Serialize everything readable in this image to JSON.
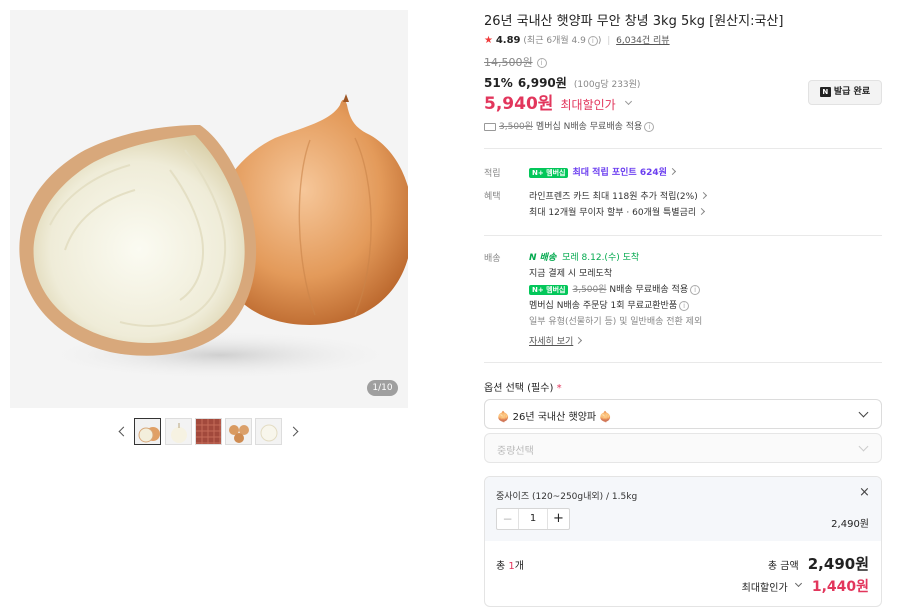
{
  "product": {
    "title": "26년 국내산 햇양파 무안 창녕 3kg 5kg [원산지:국산]",
    "rating": "4.89",
    "rating_recent": "(최근 6개월 4.9",
    "rating_recent_close": ")",
    "reviews": "6,034건 리뷰"
  },
  "gallery": {
    "counter": "1/10",
    "thumbs": [
      "onion-half",
      "onion-peeled",
      "onion-sack",
      "onion-pile",
      "onion-white"
    ]
  },
  "price": {
    "original": "14,500원",
    "discount_rate": "51%",
    "sale": "6,990원",
    "unit_price": "(100g당 233원)",
    "max_discount_price": "5,940원",
    "max_discount_label": "최대할인가",
    "coupon_button": "발급 완료",
    "delivery_strike": "3,500원",
    "delivery_note": "멤버십 N배송 무료배송 적용"
  },
  "benefits": {
    "points_label": "적립",
    "points_badge": "N+ 멤버십",
    "points_text": "최대 적립 포인트 624원",
    "benefit_label": "혜택",
    "benefit_line1": "라인프렌즈 카드 최대 118원 추가 적립(2%)",
    "benefit_line2": "최대 12개월 무이자 할부 · 60개월 특별금리"
  },
  "shipping": {
    "label": "배송",
    "brand": "N 배송",
    "arrival": "모레 8.12.(수) 도착",
    "line1": "지금 결제 시 모레도착",
    "badge": "N+ 멤버십",
    "strike": "3,500원",
    "line2_rest": "N배송 무료배송 적용",
    "line3": "멤버십 N배송 주문당 1회 무료교환반품",
    "line4": "일부 유형(선물하기 등) 및 일반배송 전환 제외",
    "more": "자세히 보기"
  },
  "options": {
    "title": "옵션 선택 (필수)",
    "required_mark": "*",
    "select1_value": "🧅 26년 국내산 햇양파 🧅",
    "select2_placeholder": "중량선택"
  },
  "selected": {
    "name": "중사이즈 (120~250g내외) / 1.5kg",
    "qty": "1",
    "minus": "−",
    "plus": "+",
    "price": "2,490원",
    "close": "×"
  },
  "total": {
    "count_prefix": "총 ",
    "count_num": "1",
    "count_suffix": "개",
    "label": "총 금액",
    "amount": "2,490원",
    "max_label": "최대할인가",
    "max_amount": "1,440원"
  },
  "colors": {
    "accent_red": "#e2365c",
    "naver_green": "#03c75a",
    "rating_star": "#f03c3c"
  }
}
